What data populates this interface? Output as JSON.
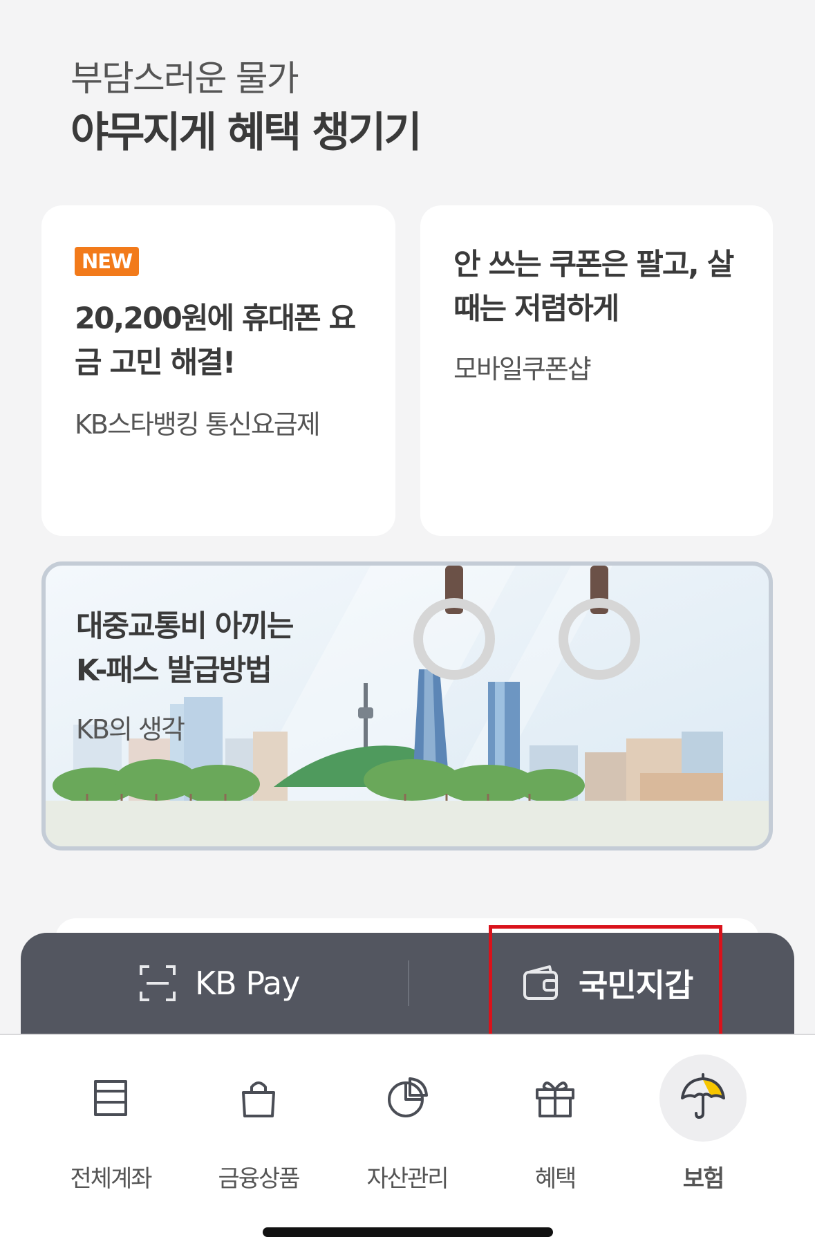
{
  "headline": {
    "subtitle": "부담스러운 물가",
    "title": "야무지게 혜택 챙기기"
  },
  "cards": [
    {
      "badge": "NEW",
      "title": "20,200원에 휴대폰 요금 고민 해결!",
      "description": "KB스타뱅킹 통신요금제"
    },
    {
      "title": "안 쓰는 쿠폰은 팔고, 살 때는 저렴하게",
      "description": "모바일쿠폰샵"
    }
  ],
  "banner": {
    "title_line1": "대중교통비 아끼는",
    "title_line2": "K-패스 발급방법",
    "description": "KB의 생각"
  },
  "pay_bar": {
    "left_label": "KB Pay",
    "left_icon": "scan-icon",
    "right_label": "국민지갑",
    "right_icon": "wallet-icon",
    "highlight_color": "#d9121b"
  },
  "tabs": [
    {
      "label": "전체계좌",
      "icon": "account-card-icon"
    },
    {
      "label": "금융상품",
      "icon": "shopping-bag-icon"
    },
    {
      "label": "자산관리",
      "icon": "pie-chart-icon"
    },
    {
      "label": "혜택",
      "icon": "gift-icon"
    },
    {
      "label": "보험",
      "icon": "umbrella-icon",
      "active": true
    }
  ],
  "colors": {
    "background": "#f4f4f5",
    "badge": "#f27a1a",
    "pay_bar": "#535660",
    "umbrella_accent": "#f7c600"
  }
}
